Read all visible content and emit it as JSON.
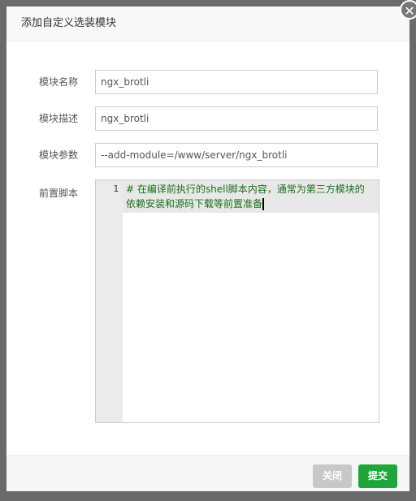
{
  "dialog": {
    "title": "添加自定义选装模块",
    "close_icon": "close-icon"
  },
  "form": {
    "name_label": "模块名称",
    "name_value": "ngx_brotli",
    "desc_label": "模块描述",
    "desc_value": "ngx_brotli",
    "params_label": "模块参数",
    "params_value": "--add-module=/www/server/ngx_brotli",
    "script_label": "前置脚本",
    "script_line_number": "1",
    "script_value": "# 在编译前执行的shell脚本内容，通常为第三方模块的依赖安装和源码下载等前置准备"
  },
  "footer": {
    "close_label": "关闭",
    "submit_label": "提交",
    "close_color": "#c8c8c8",
    "submit_color": "#20a53a"
  }
}
